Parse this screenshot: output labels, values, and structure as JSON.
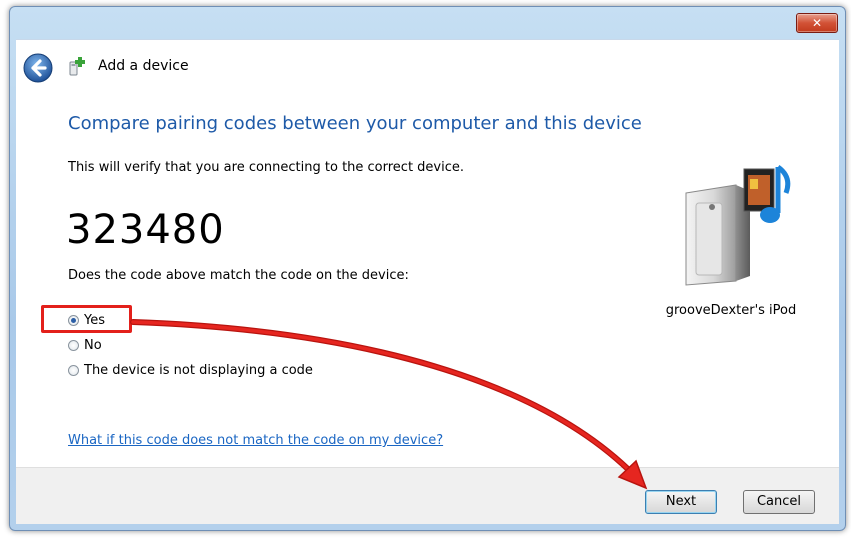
{
  "window": {
    "close_label": "✕",
    "nav_title": "Add a device"
  },
  "content": {
    "heading": "Compare pairing codes between your computer and this device",
    "description": "This will verify that you are connecting to the correct device.",
    "pairing_code": "323480",
    "question": "Does the code above match the code on the device:",
    "options": [
      {
        "label": "Yes",
        "selected": true
      },
      {
        "label": "No",
        "selected": false
      },
      {
        "label": "The device is not displaying a code",
        "selected": false
      }
    ],
    "help_link": "What if this code does not match the code on my device?",
    "device_name": "grooveDexter's iPod"
  },
  "footer": {
    "next_label": "Next",
    "cancel_label": "Cancel"
  },
  "icons": {
    "back": "back-arrow-icon",
    "add_device": "add-device-icon",
    "device": "media-device-icon"
  },
  "colors": {
    "heading": "#1e5aa8",
    "link": "#1a66c3",
    "annotation": "#e3201b"
  }
}
